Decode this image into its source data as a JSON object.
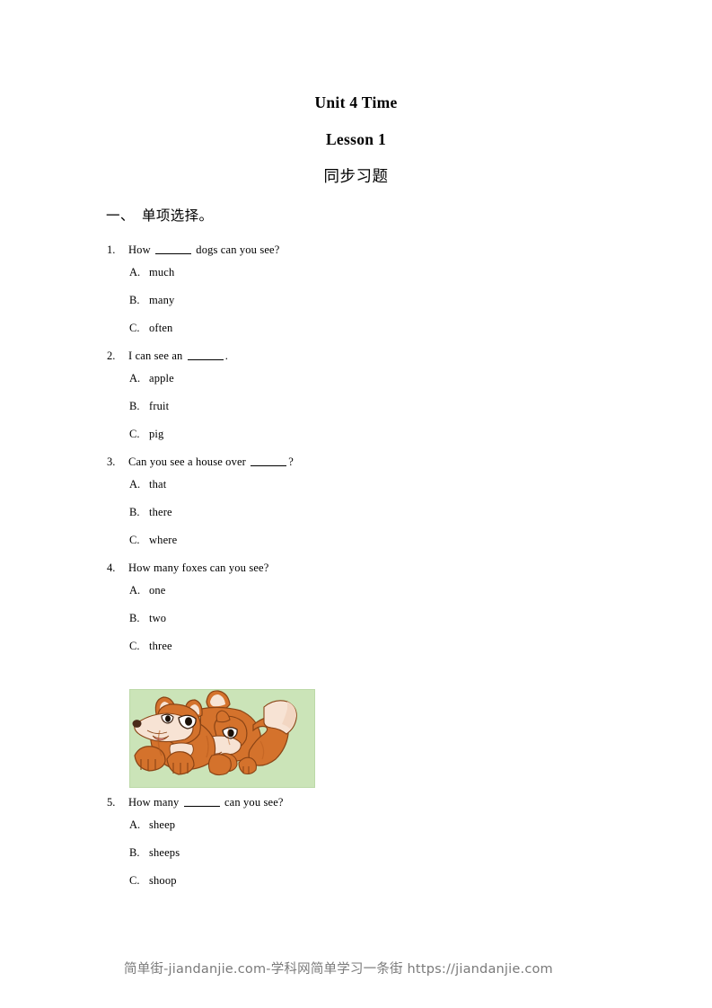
{
  "document": {
    "title_main": "Unit 4 Time",
    "title_sub": "Lesson 1",
    "title_cn": "同步习题"
  },
  "section": {
    "heading": "一、　单项选择。"
  },
  "questions": [
    {
      "number": "1.",
      "stem_before": "How ",
      "stem_after": " dogs can you see?",
      "has_blank": true,
      "options": [
        {
          "letter": "A.",
          "text": "much"
        },
        {
          "letter": "B.",
          "text": "many"
        },
        {
          "letter": "C.",
          "text": "often"
        }
      ]
    },
    {
      "number": "2.",
      "stem_before": "I can see an ",
      "stem_after": ".",
      "has_blank": true,
      "options": [
        {
          "letter": "A.",
          "text": "apple"
        },
        {
          "letter": "B.",
          "text": "fruit"
        },
        {
          "letter": "C.",
          "text": "pig"
        }
      ]
    },
    {
      "number": "3.",
      "stem_before": "Can you see a house over ",
      "stem_after": "?",
      "has_blank": true,
      "options": [
        {
          "letter": "A.",
          "text": "that"
        },
        {
          "letter": "B.",
          "text": "there"
        },
        {
          "letter": "C.",
          "text": "where"
        }
      ]
    },
    {
      "number": "4.",
      "stem_before": "How many foxes can you see?",
      "stem_after": "",
      "has_blank": false,
      "options": [
        {
          "letter": "A.",
          "text": "one"
        },
        {
          "letter": "B.",
          "text": "two"
        },
        {
          "letter": "C.",
          "text": "three"
        }
      ]
    },
    {
      "number": "5.",
      "stem_before": "How many ",
      "stem_after": " can you see?",
      "has_blank": true,
      "options": [
        {
          "letter": "A.",
          "text": "sheep"
        },
        {
          "letter": "B.",
          "text": "sheeps"
        },
        {
          "letter": "C.",
          "text": "shoop"
        }
      ]
    }
  ],
  "figure": {
    "name": "two-cartoon-foxes-illustration",
    "background_color": "#cbe4b8",
    "fox_body_color": "#d4722c",
    "fox_shadow_color": "#b55a1c",
    "fox_cream_color": "#f7e3d4",
    "fox_nose_color": "#4a2a1a",
    "border_color": "#bcd9a8"
  },
  "footer": {
    "text": "简单街-jiandanjie.com-学科网简单学习一条街 https://jiandanjie.com"
  }
}
